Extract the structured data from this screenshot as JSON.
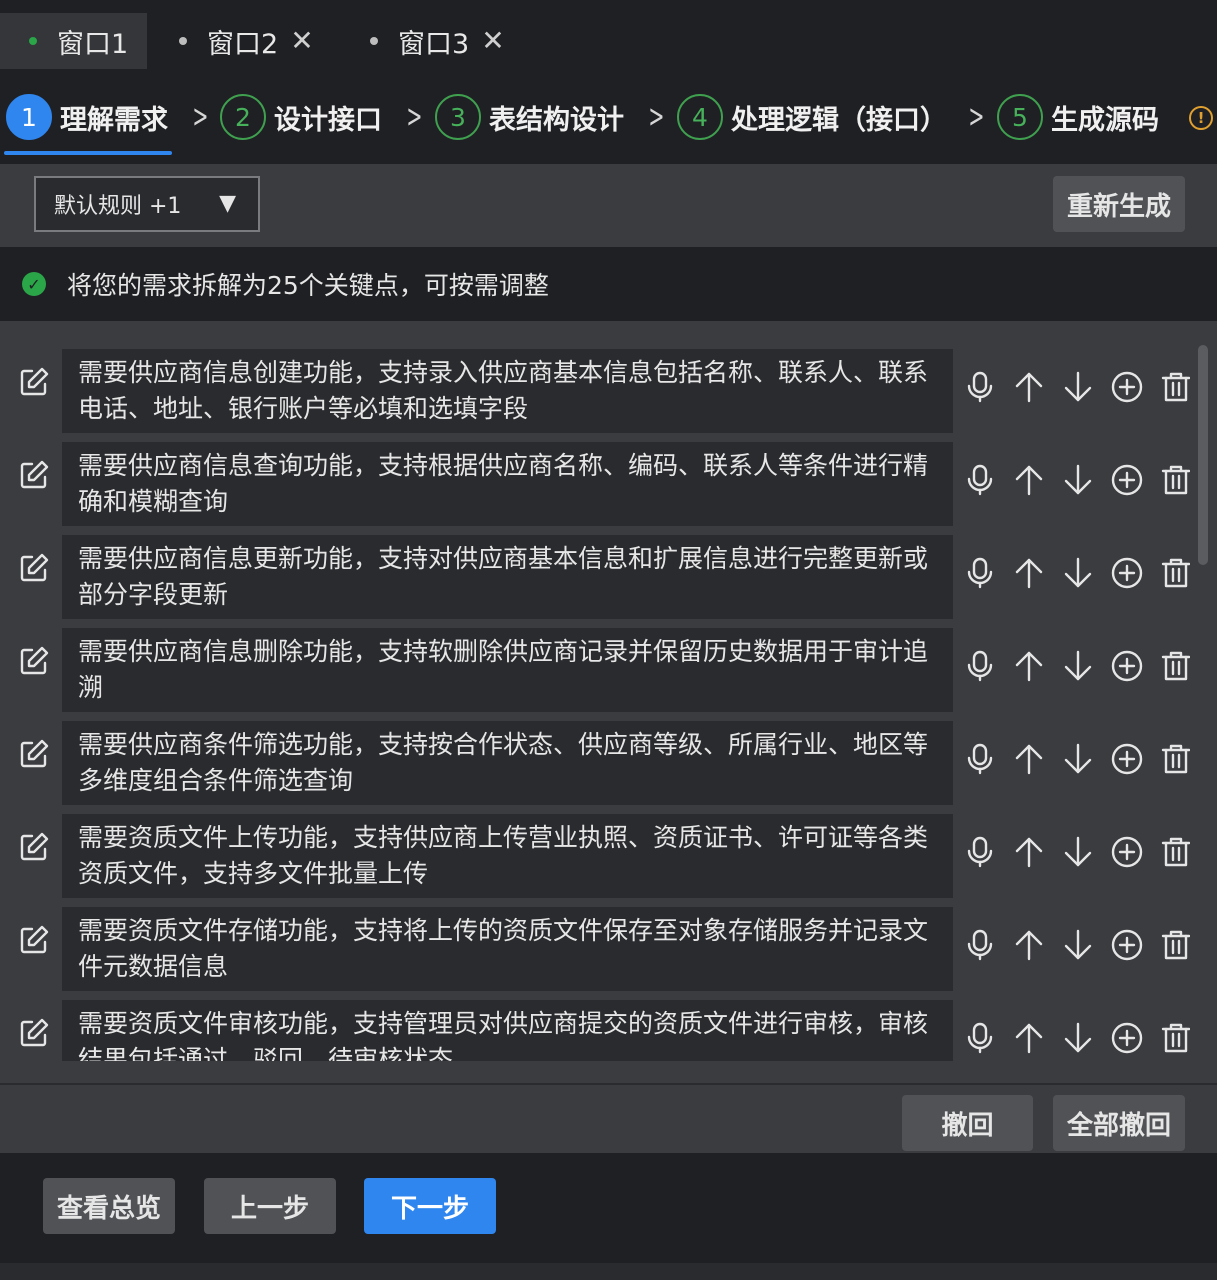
{
  "window_tabs": [
    {
      "label": "窗口1",
      "dot_color": "#2aa548",
      "active": true
    },
    {
      "label": "窗口2",
      "close": "✕"
    },
    {
      "label": "窗口3",
      "close": "✕"
    }
  ],
  "steps": [
    {
      "num": "1",
      "label": "理解需求",
      "active": true
    },
    {
      "num": "2",
      "label": "设计接口"
    },
    {
      "num": "3",
      "label": "表结构设计"
    },
    {
      "num": "4",
      "label": "处理逻辑（接口）"
    },
    {
      "num": "5",
      "label": "生成源码"
    }
  ],
  "info_icon": "!",
  "toolbar": {
    "rule_select": "默认规则 +1",
    "caret": "▼",
    "regenerate": "重新生成"
  },
  "notice": {
    "check": "✓",
    "text": "将您的需求拆解为25个关键点，可按需调整"
  },
  "items": [
    "需要供应商信息创建功能，支持录入供应商基本信息包括名称、联系人、联系电话、地址、银行账户等必填和选填字段",
    "需要供应商信息查询功能，支持根据供应商名称、编码、联系人等条件进行精确和模糊查询",
    "需要供应商信息更新功能，支持对供应商基本信息和扩展信息进行完整更新或部分字段更新",
    "需要供应商信息删除功能，支持软删除供应商记录并保留历史数据用于审计追溯",
    "需要供应商条件筛选功能，支持按合作状态、供应商等级、所属行业、地区等多维度组合条件筛选查询",
    "需要资质文件上传功能，支持供应商上传营业执照、资质证书、许可证等各类资质文件，支持多文件批量上传",
    "需要资质文件存储功能，支持将上传的资质文件保存至对象存储服务并记录文件元数据信息",
    "需要资质文件审核功能，支持管理员对供应商提交的资质文件进行审核，审核结果包括通过、驳回、待审核状态"
  ],
  "undo_bar": {
    "undo": "撤回",
    "undo_all": "全部撤回"
  },
  "footer": {
    "overview": "查看总览",
    "prev": "上一步",
    "next": "下一步"
  },
  "colors": {
    "accent": "#2f86ee",
    "success": "#2aa548",
    "warning": "#e0a030"
  }
}
